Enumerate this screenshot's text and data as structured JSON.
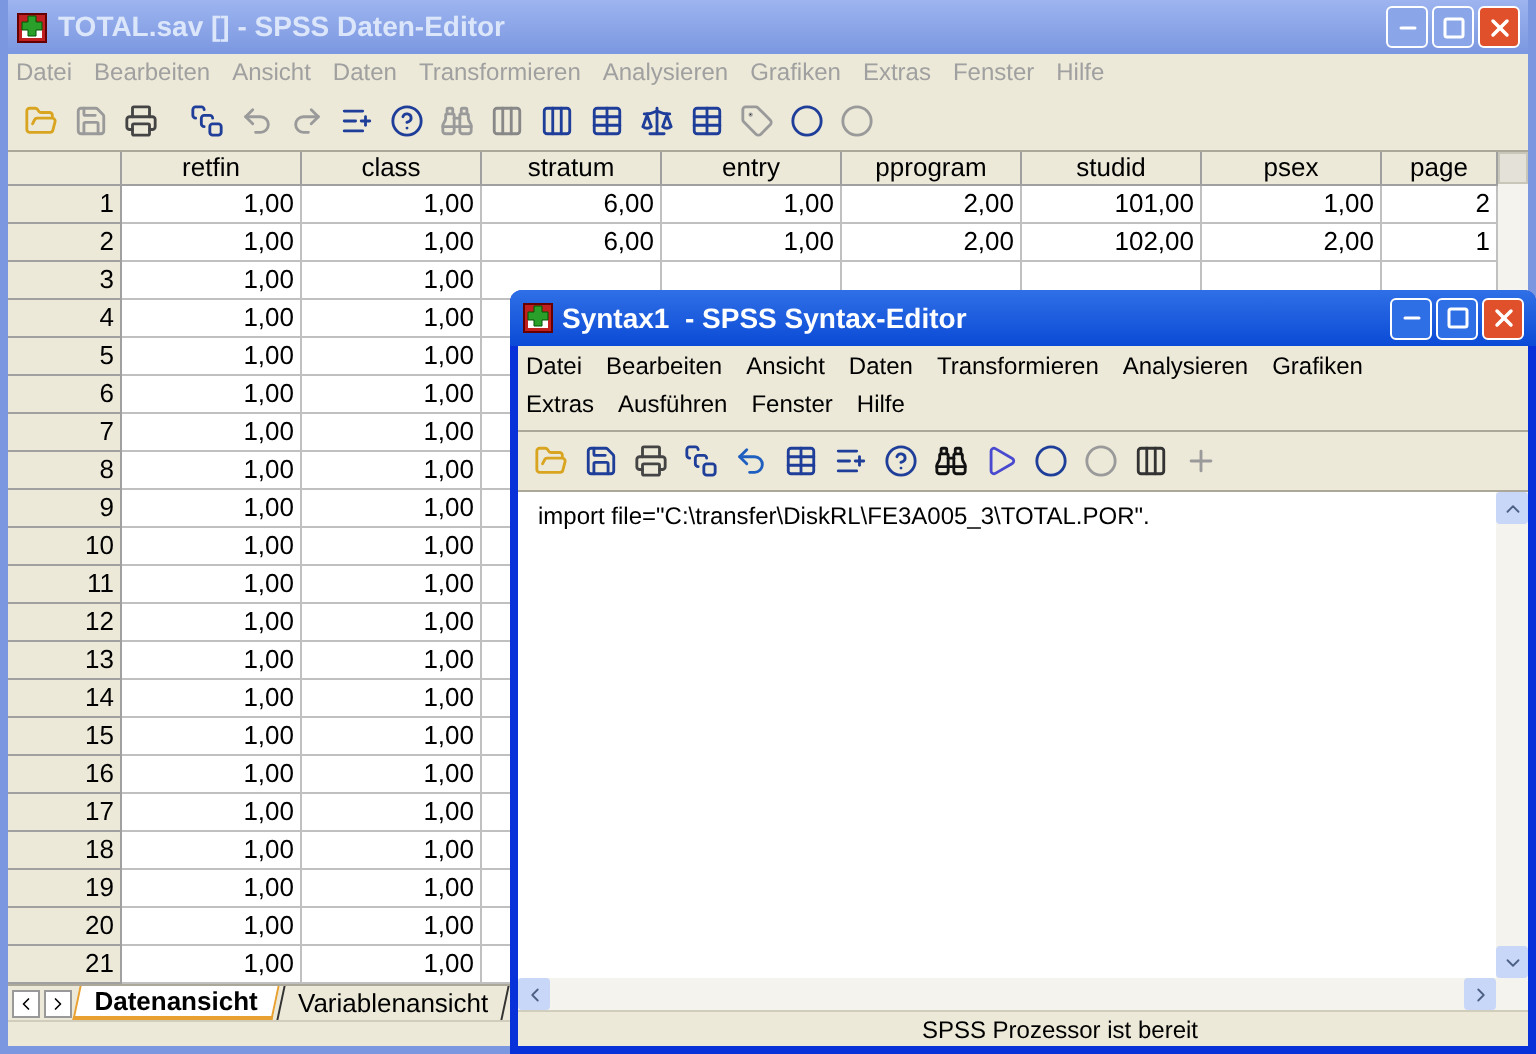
{
  "data_window": {
    "title": "TOTAL.sav [] - SPSS Daten-Editor",
    "menu": [
      "Datei",
      "Bearbeiten",
      "Ansicht",
      "Daten",
      "Transformieren",
      "Analysieren",
      "Grafiken",
      "Extras",
      "Fenster",
      "Hilfe"
    ],
    "columns": [
      "retfin",
      "class",
      "stratum",
      "entry",
      "pprogram",
      "studid",
      "psex",
      "page"
    ],
    "rows": [
      {
        "number": "1",
        "cells": [
          "1,00",
          "1,00",
          "6,00",
          "1,00",
          "2,00",
          "101,00",
          "1,00",
          "2"
        ]
      },
      {
        "number": "2",
        "cells": [
          "1,00",
          "1,00",
          "6,00",
          "1,00",
          "2,00",
          "102,00",
          "2,00",
          "1"
        ]
      },
      {
        "number": "3",
        "cells": [
          "1,00",
          "1,00"
        ]
      },
      {
        "number": "4",
        "cells": [
          "1,00",
          "1,00"
        ]
      },
      {
        "number": "5",
        "cells": [
          "1,00",
          "1,00"
        ]
      },
      {
        "number": "6",
        "cells": [
          "1,00",
          "1,00"
        ]
      },
      {
        "number": "7",
        "cells": [
          "1,00",
          "1,00"
        ]
      },
      {
        "number": "8",
        "cells": [
          "1,00",
          "1,00"
        ]
      },
      {
        "number": "9",
        "cells": [
          "1,00",
          "1,00"
        ]
      },
      {
        "number": "10",
        "cells": [
          "1,00",
          "1,00"
        ]
      },
      {
        "number": "11",
        "cells": [
          "1,00",
          "1,00"
        ]
      },
      {
        "number": "12",
        "cells": [
          "1,00",
          "1,00"
        ]
      },
      {
        "number": "13",
        "cells": [
          "1,00",
          "1,00"
        ]
      },
      {
        "number": "14",
        "cells": [
          "1,00",
          "1,00"
        ]
      },
      {
        "number": "15",
        "cells": [
          "1,00",
          "1,00"
        ]
      },
      {
        "number": "16",
        "cells": [
          "1,00",
          "1,00"
        ]
      },
      {
        "number": "17",
        "cells": [
          "1,00",
          "1,00"
        ]
      },
      {
        "number": "18",
        "cells": [
          "1,00",
          "1,00"
        ]
      },
      {
        "number": "19",
        "cells": [
          "1,00",
          "1,00"
        ]
      },
      {
        "number": "20",
        "cells": [
          "1,00",
          "1,00"
        ]
      },
      {
        "number": "21",
        "cells": [
          "1,00",
          "1,00"
        ]
      }
    ],
    "tabs": [
      {
        "label": "Datenansicht",
        "selected": true
      },
      {
        "label": "Variablenansicht",
        "selected": false
      }
    ]
  },
  "syntax_window": {
    "title": "Syntax1  - SPSS Syntax-Editor",
    "menu": [
      "Datei",
      "Bearbeiten",
      "Ansicht",
      "Daten",
      "Transformieren",
      "Analysieren",
      "Grafiken",
      "Extras",
      "Ausführen",
      "Fenster",
      "Hilfe"
    ],
    "code": "import file=\"C:\\transfer\\DiskRL\\FE3A005_3\\TOTAL.POR\".",
    "status": "SPSS Prozessor ist bereit"
  }
}
